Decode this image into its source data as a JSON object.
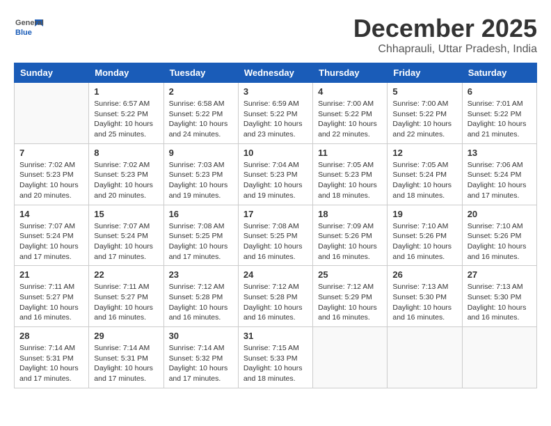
{
  "logo": {
    "general": "General",
    "blue": "Blue"
  },
  "header": {
    "month": "December 2025",
    "location": "Chhaprauli, Uttar Pradesh, India"
  },
  "weekdays": [
    "Sunday",
    "Monday",
    "Tuesday",
    "Wednesday",
    "Thursday",
    "Friday",
    "Saturday"
  ],
  "weeks": [
    [
      {
        "day": "",
        "sunrise": "",
        "sunset": "",
        "daylight": ""
      },
      {
        "day": "1",
        "sunrise": "Sunrise: 6:57 AM",
        "sunset": "Sunset: 5:22 PM",
        "daylight": "Daylight: 10 hours and 25 minutes."
      },
      {
        "day": "2",
        "sunrise": "Sunrise: 6:58 AM",
        "sunset": "Sunset: 5:22 PM",
        "daylight": "Daylight: 10 hours and 24 minutes."
      },
      {
        "day": "3",
        "sunrise": "Sunrise: 6:59 AM",
        "sunset": "Sunset: 5:22 PM",
        "daylight": "Daylight: 10 hours and 23 minutes."
      },
      {
        "day": "4",
        "sunrise": "Sunrise: 7:00 AM",
        "sunset": "Sunset: 5:22 PM",
        "daylight": "Daylight: 10 hours and 22 minutes."
      },
      {
        "day": "5",
        "sunrise": "Sunrise: 7:00 AM",
        "sunset": "Sunset: 5:22 PM",
        "daylight": "Daylight: 10 hours and 22 minutes."
      },
      {
        "day": "6",
        "sunrise": "Sunrise: 7:01 AM",
        "sunset": "Sunset: 5:22 PM",
        "daylight": "Daylight: 10 hours and 21 minutes."
      }
    ],
    [
      {
        "day": "7",
        "sunrise": "Sunrise: 7:02 AM",
        "sunset": "Sunset: 5:23 PM",
        "daylight": "Daylight: 10 hours and 20 minutes."
      },
      {
        "day": "8",
        "sunrise": "Sunrise: 7:02 AM",
        "sunset": "Sunset: 5:23 PM",
        "daylight": "Daylight: 10 hours and 20 minutes."
      },
      {
        "day": "9",
        "sunrise": "Sunrise: 7:03 AM",
        "sunset": "Sunset: 5:23 PM",
        "daylight": "Daylight: 10 hours and 19 minutes."
      },
      {
        "day": "10",
        "sunrise": "Sunrise: 7:04 AM",
        "sunset": "Sunset: 5:23 PM",
        "daylight": "Daylight: 10 hours and 19 minutes."
      },
      {
        "day": "11",
        "sunrise": "Sunrise: 7:05 AM",
        "sunset": "Sunset: 5:23 PM",
        "daylight": "Daylight: 10 hours and 18 minutes."
      },
      {
        "day": "12",
        "sunrise": "Sunrise: 7:05 AM",
        "sunset": "Sunset: 5:24 PM",
        "daylight": "Daylight: 10 hours and 18 minutes."
      },
      {
        "day": "13",
        "sunrise": "Sunrise: 7:06 AM",
        "sunset": "Sunset: 5:24 PM",
        "daylight": "Daylight: 10 hours and 17 minutes."
      }
    ],
    [
      {
        "day": "14",
        "sunrise": "Sunrise: 7:07 AM",
        "sunset": "Sunset: 5:24 PM",
        "daylight": "Daylight: 10 hours and 17 minutes."
      },
      {
        "day": "15",
        "sunrise": "Sunrise: 7:07 AM",
        "sunset": "Sunset: 5:24 PM",
        "daylight": "Daylight: 10 hours and 17 minutes."
      },
      {
        "day": "16",
        "sunrise": "Sunrise: 7:08 AM",
        "sunset": "Sunset: 5:25 PM",
        "daylight": "Daylight: 10 hours and 17 minutes."
      },
      {
        "day": "17",
        "sunrise": "Sunrise: 7:08 AM",
        "sunset": "Sunset: 5:25 PM",
        "daylight": "Daylight: 10 hours and 16 minutes."
      },
      {
        "day": "18",
        "sunrise": "Sunrise: 7:09 AM",
        "sunset": "Sunset: 5:26 PM",
        "daylight": "Daylight: 10 hours and 16 minutes."
      },
      {
        "day": "19",
        "sunrise": "Sunrise: 7:10 AM",
        "sunset": "Sunset: 5:26 PM",
        "daylight": "Daylight: 10 hours and 16 minutes."
      },
      {
        "day": "20",
        "sunrise": "Sunrise: 7:10 AM",
        "sunset": "Sunset: 5:26 PM",
        "daylight": "Daylight: 10 hours and 16 minutes."
      }
    ],
    [
      {
        "day": "21",
        "sunrise": "Sunrise: 7:11 AM",
        "sunset": "Sunset: 5:27 PM",
        "daylight": "Daylight: 10 hours and 16 minutes."
      },
      {
        "day": "22",
        "sunrise": "Sunrise: 7:11 AM",
        "sunset": "Sunset: 5:27 PM",
        "daylight": "Daylight: 10 hours and 16 minutes."
      },
      {
        "day": "23",
        "sunrise": "Sunrise: 7:12 AM",
        "sunset": "Sunset: 5:28 PM",
        "daylight": "Daylight: 10 hours and 16 minutes."
      },
      {
        "day": "24",
        "sunrise": "Sunrise: 7:12 AM",
        "sunset": "Sunset: 5:28 PM",
        "daylight": "Daylight: 10 hours and 16 minutes."
      },
      {
        "day": "25",
        "sunrise": "Sunrise: 7:12 AM",
        "sunset": "Sunset: 5:29 PM",
        "daylight": "Daylight: 10 hours and 16 minutes."
      },
      {
        "day": "26",
        "sunrise": "Sunrise: 7:13 AM",
        "sunset": "Sunset: 5:30 PM",
        "daylight": "Daylight: 10 hours and 16 minutes."
      },
      {
        "day": "27",
        "sunrise": "Sunrise: 7:13 AM",
        "sunset": "Sunset: 5:30 PM",
        "daylight": "Daylight: 10 hours and 16 minutes."
      }
    ],
    [
      {
        "day": "28",
        "sunrise": "Sunrise: 7:14 AM",
        "sunset": "Sunset: 5:31 PM",
        "daylight": "Daylight: 10 hours and 17 minutes."
      },
      {
        "day": "29",
        "sunrise": "Sunrise: 7:14 AM",
        "sunset": "Sunset: 5:31 PM",
        "daylight": "Daylight: 10 hours and 17 minutes."
      },
      {
        "day": "30",
        "sunrise": "Sunrise: 7:14 AM",
        "sunset": "Sunset: 5:32 PM",
        "daylight": "Daylight: 10 hours and 17 minutes."
      },
      {
        "day": "31",
        "sunrise": "Sunrise: 7:15 AM",
        "sunset": "Sunset: 5:33 PM",
        "daylight": "Daylight: 10 hours and 18 minutes."
      },
      {
        "day": "",
        "sunrise": "",
        "sunset": "",
        "daylight": ""
      },
      {
        "day": "",
        "sunrise": "",
        "sunset": "",
        "daylight": ""
      },
      {
        "day": "",
        "sunrise": "",
        "sunset": "",
        "daylight": ""
      }
    ]
  ]
}
